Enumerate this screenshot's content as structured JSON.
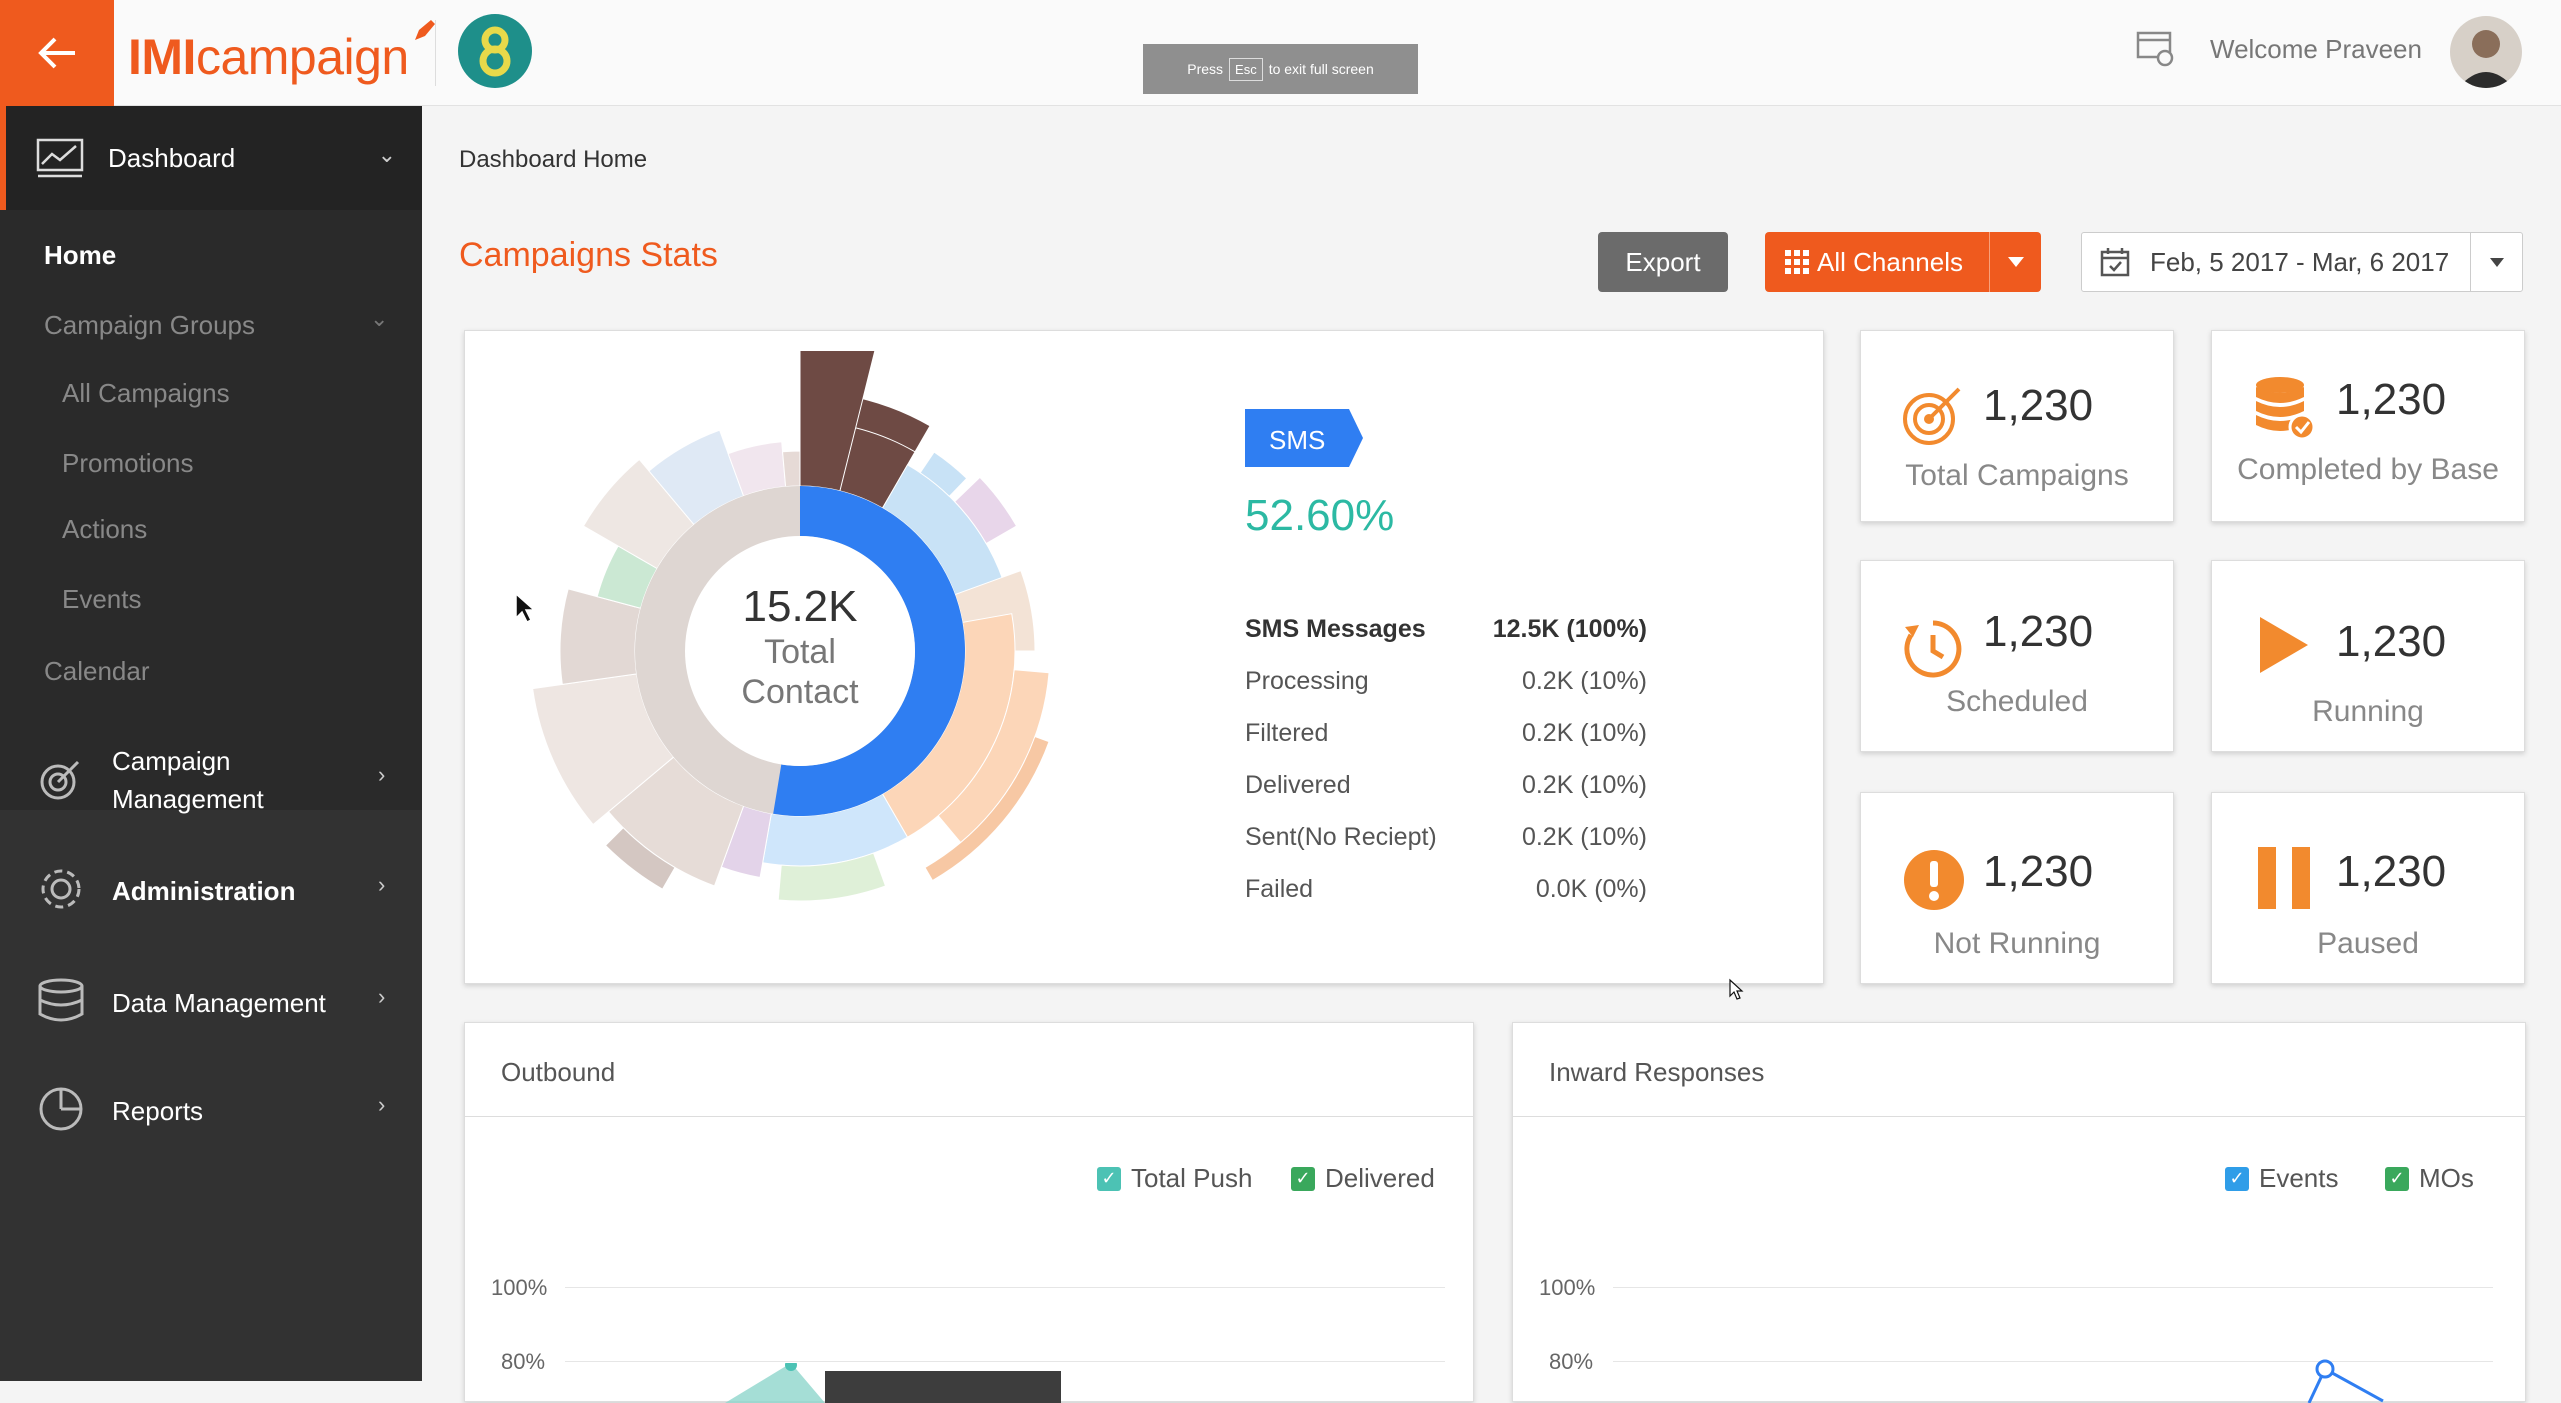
{
  "topbar": {
    "logo_imi": "IMI",
    "logo_campaign": "campaign",
    "fullscreen_toast_before": "Press",
    "fullscreen_toast_key": "Esc",
    "fullscreen_toast_after": "to exit full screen",
    "welcome": "Welcome Praveen"
  },
  "sidebar": {
    "dashboard": "Dashboard",
    "home": "Home",
    "campaign_groups": "Campaign Groups",
    "all_campaigns": "All Campaigns",
    "promotions": "Promotions",
    "actions": "Actions",
    "events": "Events",
    "calendar": "Calendar",
    "campaign_management_1": "Campaign",
    "campaign_management_2": "Management",
    "administration": "Administration",
    "data_management": "Data Management",
    "reports": "Reports"
  },
  "main": {
    "breadcrumb": "Dashboard Home",
    "title": "Campaigns Stats",
    "export": "Export",
    "all_channels": "All Channels",
    "date_range": "Feb, 5 2017 - Mar, 6 2017"
  },
  "donut": {
    "center_value": "15.2K",
    "center_label_1": "Total",
    "center_label_2": "Contact",
    "sms_share_percent": 52.6,
    "colors": {
      "sms": "#2f7ef2",
      "inner": "#ded6d2",
      "brown": "#6e4a44",
      "peach": "#fcd6b8"
    }
  },
  "sms": {
    "badge": "SMS",
    "percent": "52.60%",
    "rows": [
      {
        "label": "SMS Messages",
        "value": "12.5K (100%)"
      },
      {
        "label": "Processing",
        "value": "0.2K (10%)"
      },
      {
        "label": "Filtered",
        "value": "0.2K (10%)"
      },
      {
        "label": "Delivered",
        "value": "0.2K (10%)"
      },
      {
        "label": "Sent(No Reciept)",
        "value": "0.2K (10%)"
      },
      {
        "label": "Failed",
        "value": "0.0K (0%)"
      }
    ]
  },
  "stats": {
    "total_campaigns": {
      "value": "1,230",
      "label": "Total Campaigns"
    },
    "completed_by_base": {
      "value": "1,230",
      "label": "Completed by Base"
    },
    "scheduled": {
      "value": "1,230",
      "label": "Scheduled"
    },
    "running": {
      "value": "1,230",
      "label": "Running"
    },
    "not_running": {
      "value": "1,230",
      "label": "Not Running"
    },
    "paused": {
      "value": "1,230",
      "label": "Paused"
    }
  },
  "outbound": {
    "title": "Outbound",
    "legend": [
      "Total Push",
      "Delivered"
    ],
    "y_ticks": [
      "100%",
      "80%"
    ]
  },
  "inward": {
    "title": "Inward Responses",
    "legend": [
      "Events",
      "MOs"
    ],
    "y_ticks": [
      "100%",
      "80%"
    ]
  },
  "accent": "#ef5a1e"
}
